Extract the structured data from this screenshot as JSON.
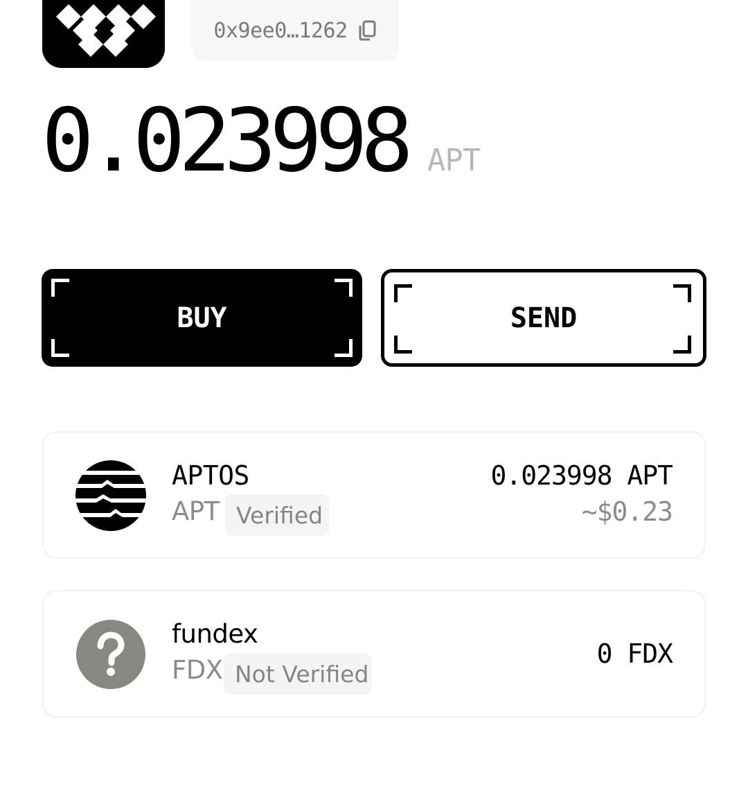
{
  "wallet": {
    "address_short": "0x9ee0…1262",
    "avatar_icon": "checker-pattern-avatar",
    "copy_icon": "copy-icon"
  },
  "balance": {
    "amount": "0.023998",
    "unit": "APT"
  },
  "actions": {
    "buy_label": "BUY",
    "send_label": "SEND"
  },
  "tokens": [
    {
      "name": "APTOS",
      "symbol": "APT",
      "badge": "Verified",
      "amount": "0.023998 APT",
      "fiat": "~$0.23",
      "icon": "aptos-logo-icon"
    },
    {
      "name": "fundex",
      "symbol": "FDX",
      "badge": "Not Verified",
      "amount": "0 FDX",
      "icon": "question-mark-icon",
      "icon_color": "#8a8780"
    }
  ]
}
